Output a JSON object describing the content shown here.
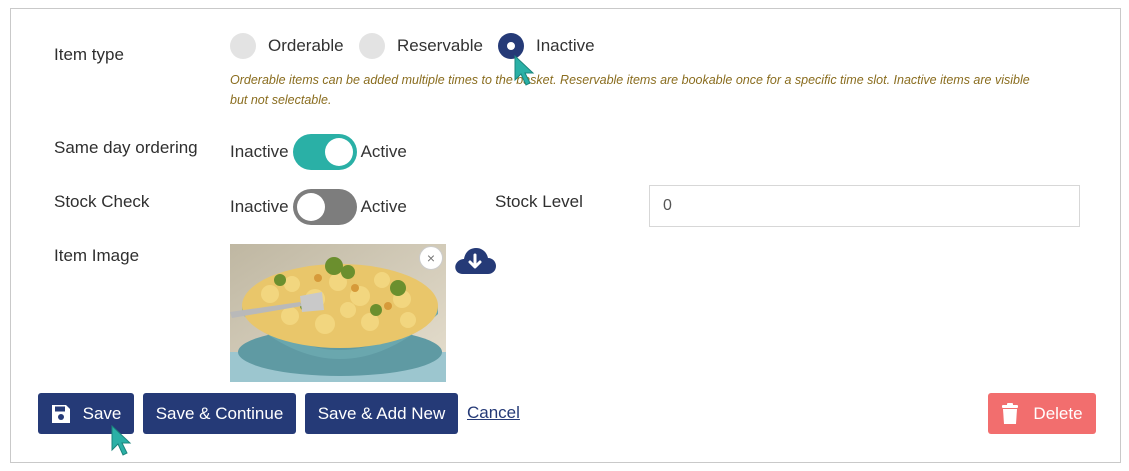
{
  "form": {
    "item_type": {
      "label": "Item type",
      "options": [
        "Orderable",
        "Reservable",
        "Inactive"
      ],
      "selected": "Inactive",
      "hint": "Orderable items can be added multiple times to the basket. Reservable items are bookable once for a specific time slot. Inactive items are visible but not selectable."
    },
    "same_day": {
      "label": "Same day ordering",
      "off_text": "Inactive",
      "on_text": "Active",
      "state": "active"
    },
    "stock_check": {
      "label": "Stock Check",
      "off_text": "Inactive",
      "on_text": "Active",
      "state": "inactive"
    },
    "stock_level": {
      "label": "Stock Level",
      "value": "0"
    },
    "item_image": {
      "label": "Item Image",
      "remove_glyph": "×"
    }
  },
  "actions": {
    "save": "Save",
    "save_continue": "Save & Continue",
    "save_add_new": "Save & Add New",
    "cancel": "Cancel",
    "delete": "Delete"
  },
  "colors": {
    "primary": "#253a77",
    "toggle_on": "#2ab0a6",
    "toggle_off": "#7d7d7d",
    "danger": "#f26e6e",
    "hint": "#8a6d1f",
    "cursor": "#2ab0a6"
  },
  "icons": {
    "save": "floppy-disk-icon",
    "delete": "trash-icon",
    "upload": "cloud-download-icon",
    "remove": "close-icon"
  }
}
